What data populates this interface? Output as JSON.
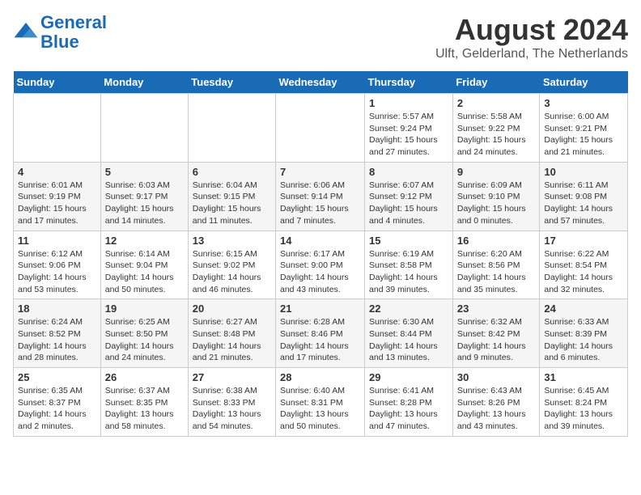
{
  "logo": {
    "line1": "General",
    "line2": "Blue"
  },
  "title": "August 2024",
  "subtitle": "Ulft, Gelderland, The Netherlands",
  "days_of_week": [
    "Sunday",
    "Monday",
    "Tuesday",
    "Wednesday",
    "Thursday",
    "Friday",
    "Saturday"
  ],
  "weeks": [
    [
      {
        "day": "",
        "info": ""
      },
      {
        "day": "",
        "info": ""
      },
      {
        "day": "",
        "info": ""
      },
      {
        "day": "",
        "info": ""
      },
      {
        "day": "1",
        "info": "Sunrise: 5:57 AM\nSunset: 9:24 PM\nDaylight: 15 hours and 27 minutes."
      },
      {
        "day": "2",
        "info": "Sunrise: 5:58 AM\nSunset: 9:22 PM\nDaylight: 15 hours and 24 minutes."
      },
      {
        "day": "3",
        "info": "Sunrise: 6:00 AM\nSunset: 9:21 PM\nDaylight: 15 hours and 21 minutes."
      }
    ],
    [
      {
        "day": "4",
        "info": "Sunrise: 6:01 AM\nSunset: 9:19 PM\nDaylight: 15 hours and 17 minutes."
      },
      {
        "day": "5",
        "info": "Sunrise: 6:03 AM\nSunset: 9:17 PM\nDaylight: 15 hours and 14 minutes."
      },
      {
        "day": "6",
        "info": "Sunrise: 6:04 AM\nSunset: 9:15 PM\nDaylight: 15 hours and 11 minutes."
      },
      {
        "day": "7",
        "info": "Sunrise: 6:06 AM\nSunset: 9:14 PM\nDaylight: 15 hours and 7 minutes."
      },
      {
        "day": "8",
        "info": "Sunrise: 6:07 AM\nSunset: 9:12 PM\nDaylight: 15 hours and 4 minutes."
      },
      {
        "day": "9",
        "info": "Sunrise: 6:09 AM\nSunset: 9:10 PM\nDaylight: 15 hours and 0 minutes."
      },
      {
        "day": "10",
        "info": "Sunrise: 6:11 AM\nSunset: 9:08 PM\nDaylight: 14 hours and 57 minutes."
      }
    ],
    [
      {
        "day": "11",
        "info": "Sunrise: 6:12 AM\nSunset: 9:06 PM\nDaylight: 14 hours and 53 minutes."
      },
      {
        "day": "12",
        "info": "Sunrise: 6:14 AM\nSunset: 9:04 PM\nDaylight: 14 hours and 50 minutes."
      },
      {
        "day": "13",
        "info": "Sunrise: 6:15 AM\nSunset: 9:02 PM\nDaylight: 14 hours and 46 minutes."
      },
      {
        "day": "14",
        "info": "Sunrise: 6:17 AM\nSunset: 9:00 PM\nDaylight: 14 hours and 43 minutes."
      },
      {
        "day": "15",
        "info": "Sunrise: 6:19 AM\nSunset: 8:58 PM\nDaylight: 14 hours and 39 minutes."
      },
      {
        "day": "16",
        "info": "Sunrise: 6:20 AM\nSunset: 8:56 PM\nDaylight: 14 hours and 35 minutes."
      },
      {
        "day": "17",
        "info": "Sunrise: 6:22 AM\nSunset: 8:54 PM\nDaylight: 14 hours and 32 minutes."
      }
    ],
    [
      {
        "day": "18",
        "info": "Sunrise: 6:24 AM\nSunset: 8:52 PM\nDaylight: 14 hours and 28 minutes."
      },
      {
        "day": "19",
        "info": "Sunrise: 6:25 AM\nSunset: 8:50 PM\nDaylight: 14 hours and 24 minutes."
      },
      {
        "day": "20",
        "info": "Sunrise: 6:27 AM\nSunset: 8:48 PM\nDaylight: 14 hours and 21 minutes."
      },
      {
        "day": "21",
        "info": "Sunrise: 6:28 AM\nSunset: 8:46 PM\nDaylight: 14 hours and 17 minutes."
      },
      {
        "day": "22",
        "info": "Sunrise: 6:30 AM\nSunset: 8:44 PM\nDaylight: 14 hours and 13 minutes."
      },
      {
        "day": "23",
        "info": "Sunrise: 6:32 AM\nSunset: 8:42 PM\nDaylight: 14 hours and 9 minutes."
      },
      {
        "day": "24",
        "info": "Sunrise: 6:33 AM\nSunset: 8:39 PM\nDaylight: 14 hours and 6 minutes."
      }
    ],
    [
      {
        "day": "25",
        "info": "Sunrise: 6:35 AM\nSunset: 8:37 PM\nDaylight: 14 hours and 2 minutes."
      },
      {
        "day": "26",
        "info": "Sunrise: 6:37 AM\nSunset: 8:35 PM\nDaylight: 13 hours and 58 minutes."
      },
      {
        "day": "27",
        "info": "Sunrise: 6:38 AM\nSunset: 8:33 PM\nDaylight: 13 hours and 54 minutes."
      },
      {
        "day": "28",
        "info": "Sunrise: 6:40 AM\nSunset: 8:31 PM\nDaylight: 13 hours and 50 minutes."
      },
      {
        "day": "29",
        "info": "Sunrise: 6:41 AM\nSunset: 8:28 PM\nDaylight: 13 hours and 47 minutes."
      },
      {
        "day": "30",
        "info": "Sunrise: 6:43 AM\nSunset: 8:26 PM\nDaylight: 13 hours and 43 minutes."
      },
      {
        "day": "31",
        "info": "Sunrise: 6:45 AM\nSunset: 8:24 PM\nDaylight: 13 hours and 39 minutes."
      }
    ]
  ]
}
